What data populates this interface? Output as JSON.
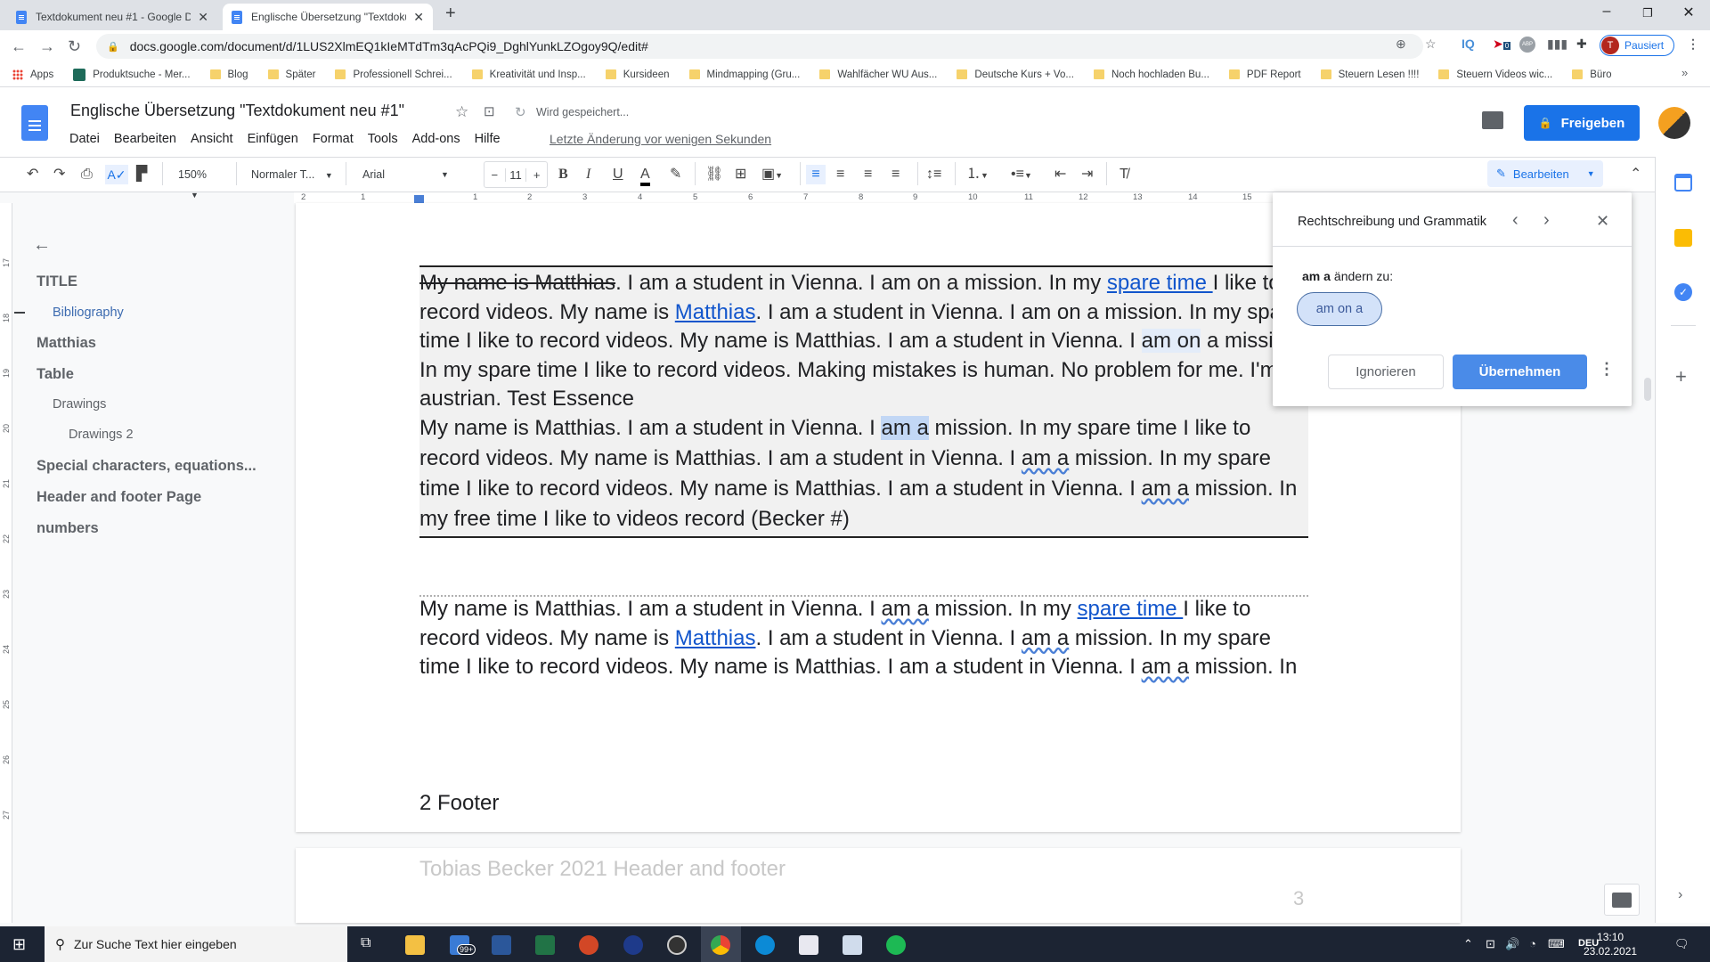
{
  "browser": {
    "tabs": [
      {
        "label": "Textdokument neu #1 - Google D",
        "active": false
      },
      {
        "label": "Englische Übersetzung \"Textdoku",
        "active": true
      }
    ],
    "new_tab": "+",
    "url": "docs.google.com/document/d/1LUS2XlmEQ1kIeMTdTm3qAcPQi9_DghlYunkLZOgoy9Q/edit#",
    "profile": {
      "initial": "T",
      "label": "Pausiert"
    },
    "extensions": [
      "IQ",
      "0",
      "ABP"
    ],
    "bookmarks": [
      "Apps",
      "Produktsuche - Mer...",
      "Blog",
      "Später",
      "Professionell Schrei...",
      "Kreativität und Insp...",
      "Kursideen",
      "Mindmapping  (Gru...",
      "Wahlfächer WU Aus...",
      "Deutsche Kurs + Vo...",
      "Noch hochladen Bu...",
      "PDF Report",
      "Steuern Lesen !!!!",
      "Steuern Videos wic...",
      "Büro"
    ],
    "more_bookmarks": "»"
  },
  "docs": {
    "title": "Englische Übersetzung \"Textdokument neu #1\"",
    "save_status": "Wird gespeichert...",
    "menu": [
      "Datei",
      "Bearbeiten",
      "Ansicht",
      "Einfügen",
      "Format",
      "Tools",
      "Add-ons",
      "Hilfe"
    ],
    "last_edit": "Letzte Änderung vor wenigen Sekunden",
    "share_label": "Freigeben",
    "toolbar": {
      "zoom": "150%",
      "style": "Normaler T...",
      "font": "Arial",
      "font_size": "11",
      "minus": "−",
      "plus": "+",
      "bold": "B",
      "italic": "I",
      "underline": "U",
      "text_color": "A",
      "mode": "Bearbeiten"
    },
    "ruler_h": [
      "2",
      "1",
      "1",
      "2",
      "3",
      "4",
      "5",
      "6",
      "7",
      "8",
      "9",
      "10",
      "11",
      "12",
      "13",
      "14",
      "15"
    ],
    "ruler_v": [
      "17",
      "18",
      "19",
      "20",
      "21",
      "22",
      "23",
      "24",
      "25",
      "26",
      "27"
    ]
  },
  "outline": {
    "items": [
      {
        "label": "TITLE",
        "level": 1
      },
      {
        "label": "Bibliography",
        "level": 2,
        "active": true
      },
      {
        "label": "Matthias",
        "level": 1
      },
      {
        "label": "Table",
        "level": 1
      },
      {
        "label": "Drawings",
        "level": 2
      },
      {
        "label": "Drawings 2",
        "level": 3
      },
      {
        "label": "Special characters, equations...",
        "level": 1
      },
      {
        "label": "Header and footer Page",
        "level": 1
      },
      {
        "label": "numbers",
        "level": 1
      }
    ]
  },
  "document": {
    "table_para1": {
      "strike": "My name is Matthias",
      "t1": ". I am a student in Vienna. I am on a mission. In my ",
      "link1": "spare time ",
      "t2": "I like to record videos. My name is ",
      "link2": "Matthias",
      "t3": ". I am a student in Vienna. I am on a mission. In my spare time I like to record videos. My name is Matthias. I am a student in Vienna. I ",
      "hl": "am on",
      "t4": " a mission. In my spare time I like to record videos. Making mistakes is human. No problem for me. I'm austrian. Test Essence"
    },
    "table_para2": {
      "t1": "My name is Matthias. I am a student in Vienna. I ",
      "sel": "am a",
      "t2": " mission. In my spare time I like to record videos. My name is Matthias. I am a student in Vienna. I ",
      "err1": "am a",
      "t3": " mission. In my spare time I like to record videos. My name is Matthias. I am a student in Vienna. I ",
      "err2": "am a",
      "t4": " mission. In my free time I like to videos record (Becker #)"
    },
    "body_para": {
      "t1": "My name is Matthias. I am a student in Vienna. I ",
      "err1": "am a",
      "t2": " mission. In my ",
      "link1": "spare time ",
      "t3": "I like to record videos. My name is ",
      "link2": "Matthias",
      "t4": ". I am a student in Vienna. I ",
      "err2": "am a",
      "t5": " mission. In my spare time I like to record videos. My name is Matthias. I am a student in Vienna. I ",
      "err3": "am a",
      "t6": " mission. In"
    },
    "footer": "2 Footer",
    "next_header": "Tobias Becker 2021 Header and footer",
    "next_page_number": "3"
  },
  "spellcheck": {
    "title": "Rechtschreibung und Grammatik",
    "original": "am a",
    "change_to": "ändern zu:",
    "suggestion": "am on a",
    "ignore": "Ignorieren",
    "apply": "Übernehmen"
  },
  "taskbar": {
    "search_placeholder": "Zur Suche Text hier eingeben",
    "mail_badge": "99+",
    "language": "DEU",
    "time": "13:10",
    "date": "23.02.2021"
  }
}
